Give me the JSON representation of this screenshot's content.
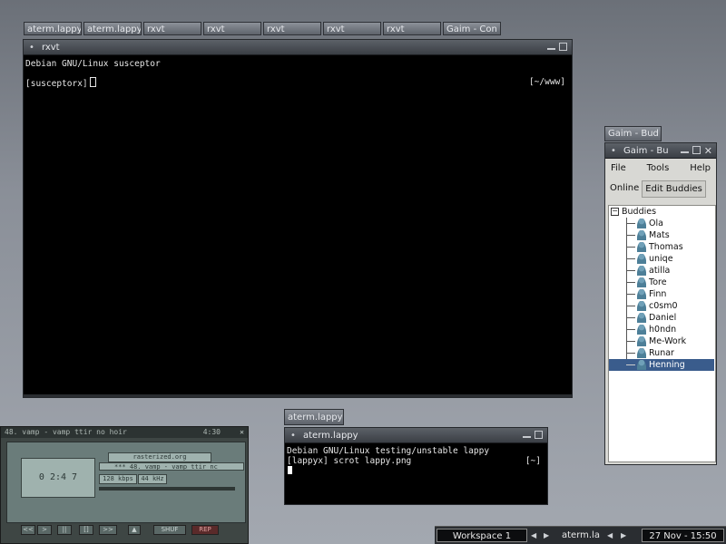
{
  "window_tabs": [
    "aterm.lappy",
    "aterm.lappy",
    "rxvt",
    "rxvt",
    "rxvt",
    "rxvt",
    "rxvt",
    "Gaim - Con"
  ],
  "rxvt": {
    "title": "rxvt",
    "line1": "Debian GNU/Linux susceptor",
    "prompt": "[susceptorx]",
    "cwd": "[~/www]"
  },
  "aterm": {
    "tab": "aterm.lappy",
    "title": "aterm.lappy",
    "line1": "Debian GNU/Linux testing/unstable lappy",
    "prompt": "[lappyx] scrot lappy.png",
    "cwd": "[~]"
  },
  "gaim": {
    "tab": "Gaim - Bud",
    "title": "Gaim - Bu",
    "menu": [
      "File",
      "Tools",
      "Help"
    ],
    "tabs": [
      "Online",
      "Edit Buddies"
    ],
    "group": "Buddies",
    "buddies": [
      "Ola",
      "Mats",
      "Thomas",
      "uniqe",
      "atilla",
      "Tore",
      "Finn",
      "c0sm0",
      "Daniel",
      "h0ndn",
      "Me-Work",
      "Runar",
      "Henning"
    ],
    "selected": "Henning"
  },
  "xmms": {
    "title": "48. vamp - vamp ttir no hoir",
    "time_top": "4:30",
    "time": "0 2:4 7",
    "domain": "rasterized.org",
    "track": "*** 48. vamp - vamp ttir nc",
    "bitrate": "128 kbps",
    "khz": "44 kHz",
    "shuf": "SHUF",
    "rep": "REP",
    "buttons": [
      "<<",
      ">",
      "||",
      "[]",
      ">>"
    ]
  },
  "taskbar": {
    "workspace": "Workspace 1",
    "task": "aterm.la",
    "clock": "27 Nov - 15:50"
  },
  "colors": {
    "desktop": "#8a8f98",
    "terminal_bg": "#000000",
    "selection": "#3a5c8c"
  }
}
